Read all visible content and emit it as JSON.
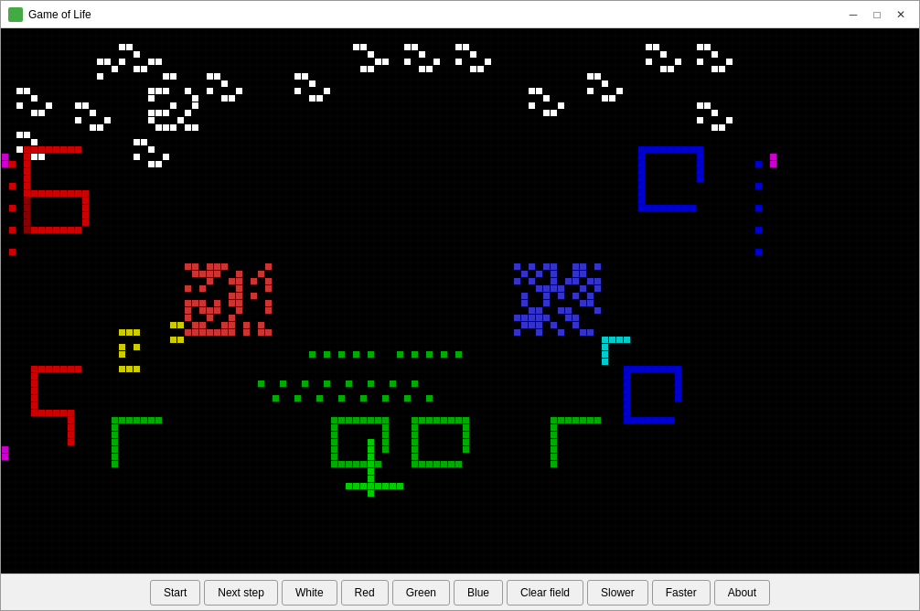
{
  "window": {
    "title": "Game of Life"
  },
  "titlebar": {
    "minimize_label": "─",
    "restore_label": "□",
    "close_label": "✕"
  },
  "toolbar": {
    "buttons": [
      {
        "id": "start",
        "label": "Start"
      },
      {
        "id": "next-step",
        "label": "Next step"
      },
      {
        "id": "white",
        "label": "White"
      },
      {
        "id": "red",
        "label": "Red"
      },
      {
        "id": "green",
        "label": "Green"
      },
      {
        "id": "blue",
        "label": "Blue"
      },
      {
        "id": "clear-field",
        "label": "Clear field"
      },
      {
        "id": "slower",
        "label": "Slower"
      },
      {
        "id": "faster",
        "label": "Faster"
      },
      {
        "id": "about",
        "label": "About"
      }
    ]
  }
}
